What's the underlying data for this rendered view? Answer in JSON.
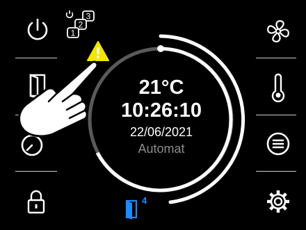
{
  "status": {
    "temperature": "21°C",
    "time": "10:26:10",
    "date": "22/06/2021",
    "mode": "Automat"
  },
  "door_indicator": {
    "count": "4",
    "color": "#1a8cff"
  },
  "program_badge": {
    "labels": [
      "1",
      "2",
      "3"
    ]
  },
  "left_buttons": [
    {
      "icon": "power-icon"
    },
    {
      "icon": "door-icon"
    },
    {
      "icon": "timer-icon"
    },
    {
      "icon": "lock-icon"
    }
  ],
  "right_buttons": [
    {
      "icon": "fan-icon"
    },
    {
      "icon": "thermometer-icon"
    },
    {
      "icon": "menu-list-icon"
    },
    {
      "icon": "gear-icon"
    }
  ],
  "colors": {
    "warning": "#f2e600",
    "ring": "#ffffff",
    "ring_inactive": "#5a5a5a",
    "accent": "#1a8cff"
  }
}
